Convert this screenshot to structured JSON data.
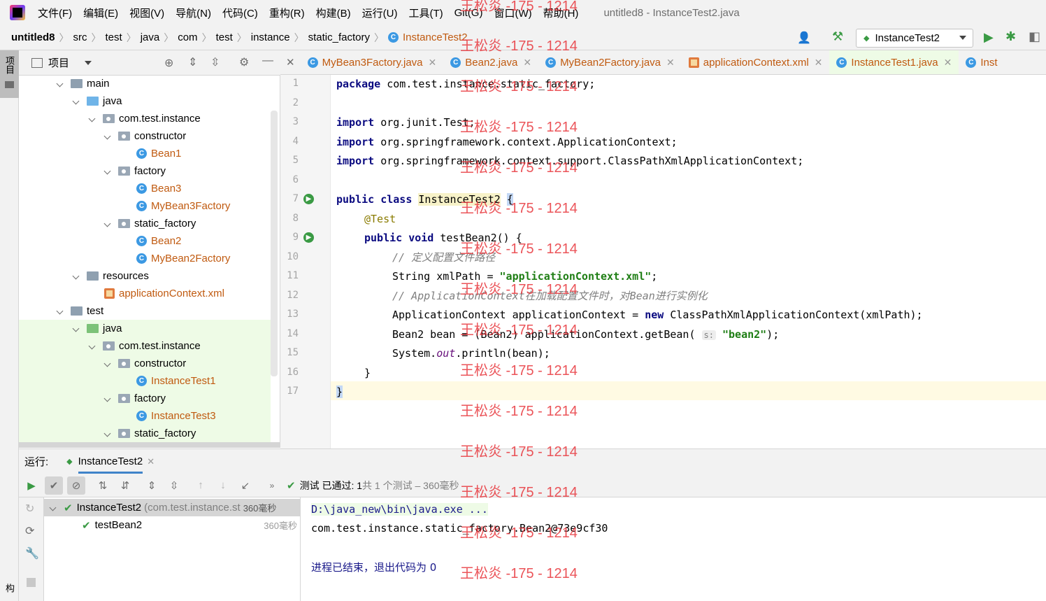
{
  "app": {
    "window_title": "untitled8 - InstanceTest2.java"
  },
  "menu": [
    "文件(F)",
    "编辑(E)",
    "视图(V)",
    "导航(N)",
    "代码(C)",
    "重构(R)",
    "构建(B)",
    "运行(U)",
    "工具(T)",
    "Git(G)",
    "窗口(W)",
    "帮助(H)"
  ],
  "breadcrumb": [
    "untitled8",
    "src",
    "test",
    "java",
    "com",
    "test",
    "instance",
    "static_factory",
    "InstanceTest2"
  ],
  "run_config": "InstanceTest2",
  "left_strip": {
    "project_tab": "项目",
    "structure_tab": "结构"
  },
  "project_panel": {
    "title": "项目"
  },
  "tree": [
    {
      "label": "main",
      "type": "folder"
    },
    {
      "label": "java",
      "type": "src"
    },
    {
      "label": "com.test.instance",
      "type": "pkg"
    },
    {
      "label": "constructor",
      "type": "pkg"
    },
    {
      "label": "Bean1",
      "type": "class"
    },
    {
      "label": "factory",
      "type": "pkg"
    },
    {
      "label": "Bean3",
      "type": "class"
    },
    {
      "label": "MyBean3Factory",
      "type": "class"
    },
    {
      "label": "static_factory",
      "type": "pkg"
    },
    {
      "label": "Bean2",
      "type": "class"
    },
    {
      "label": "MyBean2Factory",
      "type": "class"
    },
    {
      "label": "resources",
      "type": "folder"
    },
    {
      "label": "applicationContext.xml",
      "type": "xml"
    },
    {
      "label": "test",
      "type": "folder"
    },
    {
      "label": "java",
      "type": "src"
    },
    {
      "label": "com.test.instance",
      "type": "pkg"
    },
    {
      "label": "constructor",
      "type": "pkg"
    },
    {
      "label": "InstanceTest1",
      "type": "class"
    },
    {
      "label": "factory",
      "type": "pkg"
    },
    {
      "label": "InstanceTest3",
      "type": "class"
    },
    {
      "label": "static_factory",
      "type": "pkg"
    }
  ],
  "tabs": [
    "MyBean3Factory.java",
    "Bean2.java",
    "MyBean2Factory.java",
    "applicationContext.xml",
    "InstanceTest1.java",
    "Inst"
  ],
  "code": {
    "line_numbers": [
      "1",
      "2",
      "3",
      "4",
      "5",
      "6",
      "7",
      "8",
      "9",
      "10",
      "11",
      "12",
      "13",
      "14",
      "15",
      "16",
      "17"
    ],
    "l1_kw": "package",
    "l1_rest": " com.test.instance.static_factory;",
    "l3_kw": "import",
    "l3_rest": " org.junit.Test;",
    "l4_kw": "import",
    "l4_rest": " org.springframework.context.ApplicationContext;",
    "l5_kw": "import",
    "l5_rest": " org.springframework.context.support.ClassPathXmlApplicationContext;",
    "l7_kw": "public class",
    "l7_name": "InstanceTest2",
    "l7_brace": "{",
    "l8_ann": "@Test",
    "l9_kw": "public void",
    "l9_rest": " testBean2() {",
    "l10_cm": "// 定义配置文件路径",
    "l11_pre": "String xmlPath = ",
    "l11_str": "\"applicationContext.xml\"",
    "l11_end": ";",
    "l12_cm": "// ApplicationContext在加载配置文件时，对Bean进行实例化",
    "l13_pre": "ApplicationContext applicationContext = ",
    "l13_kw": "new",
    "l13_rest": " ClassPathXmlApplicationContext(xmlPath);",
    "l14_pre": "Bean2 bean = (Bean2) applicationContext.getBean(",
    "l14_hint": "s:",
    "l14_str": "\"bean2\"",
    "l14_end": ");",
    "l15_pre": "System.",
    "l15_it": "out",
    "l15_end": ".println(bean);",
    "l16": "}",
    "l17": "}"
  },
  "run": {
    "label": "运行:",
    "tab": "InstanceTest2",
    "status": "测试 已通过: 1",
    "status_detail": "共 1 个测试 – 360毫秒",
    "tests": [
      {
        "name": "InstanceTest2",
        "detail": "(com.test.instance.st",
        "time": "360毫秒"
      },
      {
        "name": "testBean2",
        "detail": "",
        "time": "360毫秒"
      }
    ],
    "console": [
      "D:\\java_new\\bin\\java.exe ...",
      "com.test.instance.static_factory.Bean2@73e9cf30",
      "",
      "进程已结束，退出代码为 0"
    ]
  },
  "watermark": "王松炎 -175 - 1214"
}
